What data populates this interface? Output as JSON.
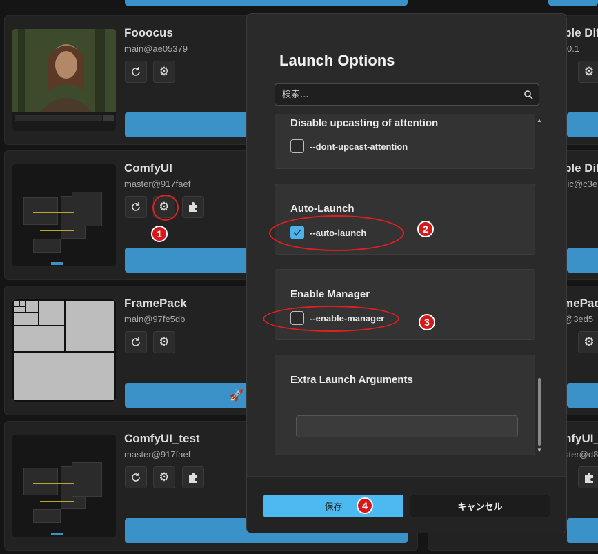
{
  "cards": [
    {
      "name": "Fooocus",
      "version": "main@ae05379"
    },
    {
      "name": "ComfyUI",
      "version": "master@917faef"
    },
    {
      "name": "FramePack",
      "version": "main@97fe5db"
    },
    {
      "name": "ComfyUI_test",
      "version": "master@917faef"
    }
  ],
  "right_cards": [
    {
      "name": "ble Dif",
      "version": "0.1"
    },
    {
      "name": "ble Dif",
      "version": "sic@c3e"
    },
    {
      "name": "mePac",
      "version": "@3ed5"
    },
    {
      "name": "nfyUI_",
      "version": "ster@d8"
    }
  ],
  "dialog": {
    "title": "Launch Options",
    "search_placeholder": "検索...",
    "options": [
      {
        "title": "Disable upcasting of attention",
        "flag": "--dont-upcast-attention",
        "checked": false
      },
      {
        "title": "Auto-Launch",
        "flag": "--auto-launch",
        "checked": true
      },
      {
        "title": "Enable Manager",
        "flag": "--enable-manager",
        "checked": false
      },
      {
        "title": "Extra Launch Arguments",
        "value": ""
      }
    ],
    "save_label": "保存",
    "cancel_label": "キャンセル"
  },
  "annotations": [
    "1",
    "2",
    "3",
    "4"
  ],
  "colors": {
    "accent": "#4cbaf0",
    "launch": "#3a92c9",
    "annotation": "#e01f1f"
  }
}
